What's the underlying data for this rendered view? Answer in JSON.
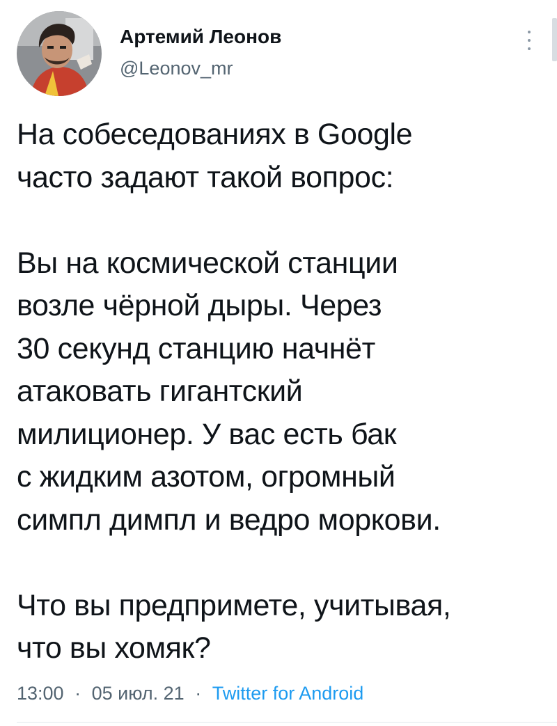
{
  "author": {
    "display_name": "Артемий Леонов",
    "handle": "@Leonov_mr",
    "avatar_icon": "user-avatar"
  },
  "tweet": {
    "paragraphs": [
      "На собеседованиях в Google\nчасто задают такой вопрос:",
      "Вы на космической станции\nвозле чёрной дыры. Через\n30 секунд станцию начнёт\nатаковать гигантский\nмилиционер. У вас есть бак\nс жидким азотом, огромный\nсимпл димпл и ведро моркови.",
      "Что вы предпримете, учитывая,\nчто вы хомяк?"
    ]
  },
  "meta": {
    "time": "13:00",
    "date": "05 июл. 21",
    "source": "Twitter for Android",
    "separator": "·"
  },
  "icons": {
    "more": "more-vertical-icon"
  },
  "colors": {
    "text": "#0f1419",
    "secondary": "#536471",
    "link": "#1d9bf0",
    "divider": "#e1e8ed"
  }
}
